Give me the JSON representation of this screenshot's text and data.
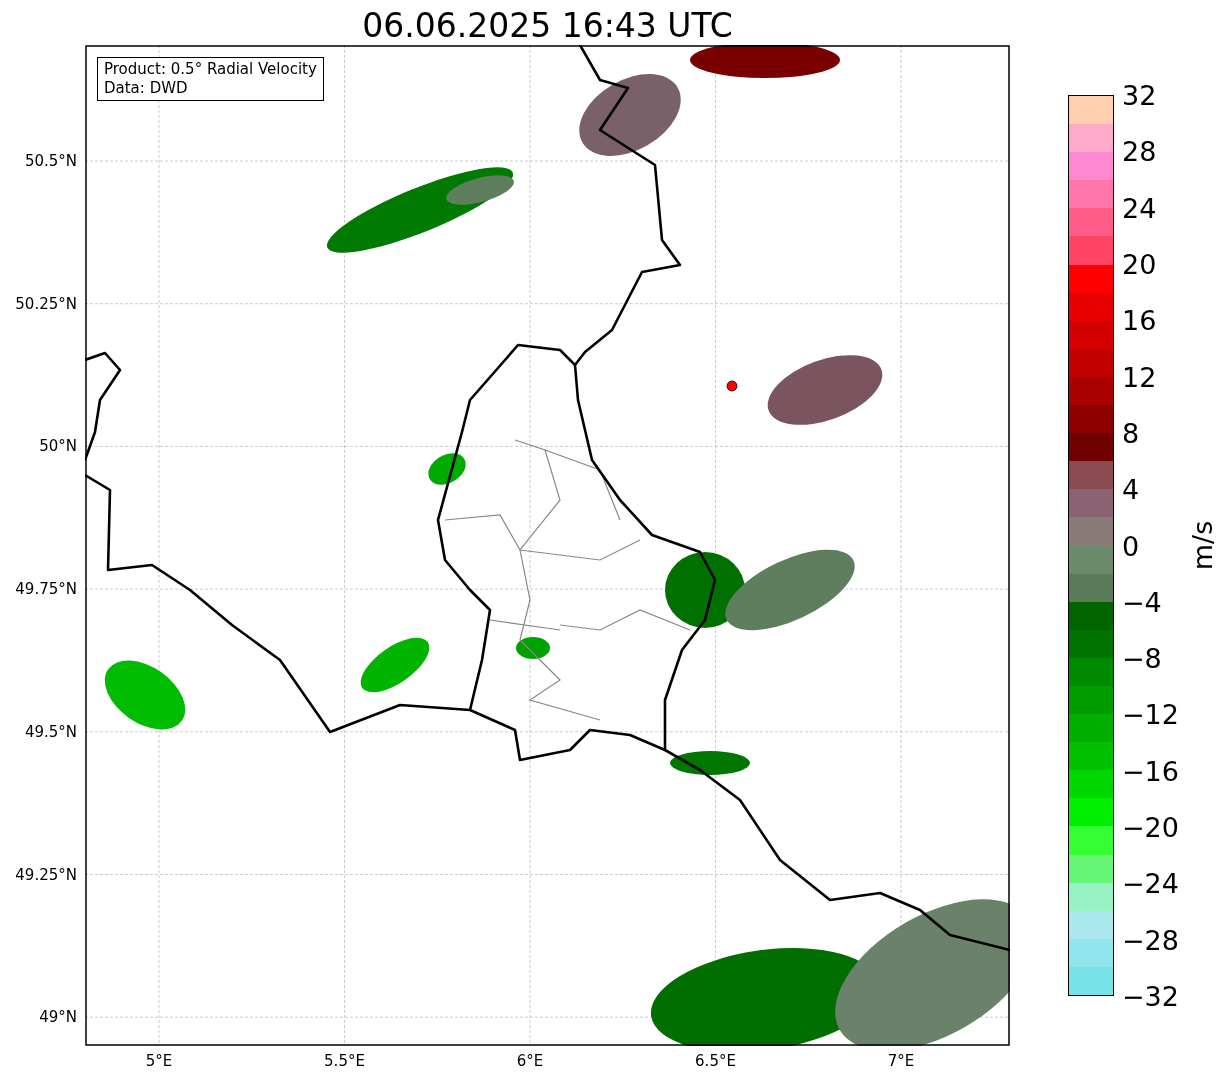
{
  "title": "06.06.2025 16:43 UTC",
  "annotation": [
    "Product: 0.5° Radial Velocity",
    "Data: DWD"
  ],
  "y_ticks": [
    "50.5°N",
    "50.25°N",
    "50°N",
    "49.75°N",
    "49.5°N",
    "49.25°N",
    "49°N"
  ],
  "x_ticks": [
    "5°E",
    "5.5°E",
    "6°E",
    "6.5°E",
    "7°E"
  ],
  "colorbar": {
    "label": "m/s",
    "ticks": [
      "32",
      "28",
      "24",
      "20",
      "16",
      "12",
      "8",
      "4",
      "0",
      "−4",
      "−8",
      "−12",
      "−16",
      "−20",
      "−24",
      "−28",
      "−32"
    ],
    "bins": [
      {
        "color": "#ffcfae"
      },
      {
        "color": "#ffaac8"
      },
      {
        "color": "#ff88d0"
      },
      {
        "color": "#ff77aa"
      },
      {
        "color": "#ff5c88"
      },
      {
        "color": "#ff4466"
      },
      {
        "color": "#ff0000"
      },
      {
        "color": "#e80000"
      },
      {
        "color": "#d40000"
      },
      {
        "color": "#c20000"
      },
      {
        "color": "#aa0000"
      },
      {
        "color": "#8e0000"
      },
      {
        "color": "#6e0000"
      },
      {
        "color": "#8a4a50"
      },
      {
        "color": "#8a6272"
      },
      {
        "color": "#8a7a78"
      },
      {
        "color": "#6a8a6a"
      },
      {
        "color": "#5a7a58"
      },
      {
        "color": "#006400"
      },
      {
        "color": "#007200"
      },
      {
        "color": "#008a00"
      },
      {
        "color": "#009c00"
      },
      {
        "color": "#00ae00"
      },
      {
        "color": "#00c000"
      },
      {
        "color": "#00d800"
      },
      {
        "color": "#00f000"
      },
      {
        "color": "#33ff33"
      },
      {
        "color": "#66f577"
      },
      {
        "color": "#99f2c4"
      },
      {
        "color": "#aae8ee"
      },
      {
        "color": "#90e6ec"
      },
      {
        "color": "#77e3e8"
      }
    ]
  }
}
